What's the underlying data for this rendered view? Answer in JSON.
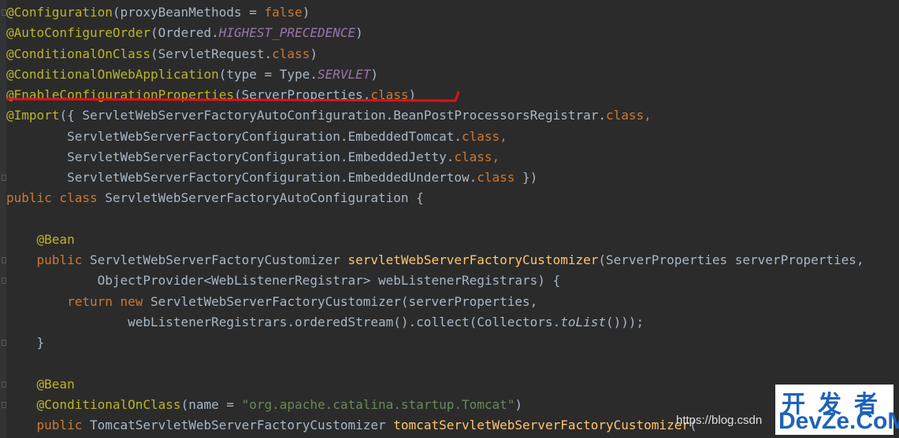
{
  "editor": {
    "lines": [
      [
        {
          "t": "@Configuration",
          "c": "ann"
        },
        {
          "t": "(proxyBeanMethods = ",
          "c": "plain"
        },
        {
          "t": "false",
          "c": "kw"
        },
        {
          "t": ")",
          "c": "plain"
        }
      ],
      [
        {
          "t": "@AutoConfigureOrder",
          "c": "ann"
        },
        {
          "t": "(Ordered.",
          "c": "plain"
        },
        {
          "t": "HIGHEST_PRECEDENCE",
          "c": "const"
        },
        {
          "t": ")",
          "c": "plain"
        }
      ],
      [
        {
          "t": "@ConditionalOnClass",
          "c": "ann"
        },
        {
          "t": "(ServletRequest.",
          "c": "plain"
        },
        {
          "t": "class",
          "c": "kw"
        },
        {
          "t": ")",
          "c": "plain"
        }
      ],
      [
        {
          "t": "@ConditionalOnWebApplication",
          "c": "ann"
        },
        {
          "t": "(type = Type.",
          "c": "plain"
        },
        {
          "t": "SERVLET",
          "c": "const"
        },
        {
          "t": ")",
          "c": "plain"
        }
      ],
      [
        {
          "t": "@EnableConfigurationProperties",
          "c": "ann"
        },
        {
          "t": "(ServerProperties.",
          "c": "plain"
        },
        {
          "t": "class",
          "c": "kw"
        },
        {
          "t": ")",
          "c": "plain"
        }
      ],
      [
        {
          "t": "@Import",
          "c": "ann"
        },
        {
          "t": "({ ServletWebServerFactoryAutoConfiguration.BeanPostProcessorsRegistrar.",
          "c": "plain"
        },
        {
          "t": "class,",
          "c": "kw"
        }
      ],
      [
        {
          "t": "        ServletWebServerFactoryConfiguration.EmbeddedTomcat.",
          "c": "plain"
        },
        {
          "t": "class,",
          "c": "kw"
        }
      ],
      [
        {
          "t": "        ServletWebServerFactoryConfiguration.EmbeddedJetty.",
          "c": "plain"
        },
        {
          "t": "class,",
          "c": "kw"
        }
      ],
      [
        {
          "t": "        ServletWebServerFactoryConfiguration.EmbeddedUndertow.",
          "c": "plain"
        },
        {
          "t": "class",
          "c": "kw"
        },
        {
          "t": " })",
          "c": "plain"
        }
      ],
      [
        {
          "t": "public class ",
          "c": "kw"
        },
        {
          "t": "ServletWebServerFactoryAutoConfiguration {",
          "c": "plain"
        }
      ],
      [
        {
          "t": "",
          "c": "plain"
        }
      ],
      [
        {
          "t": "    ",
          "c": "plain"
        },
        {
          "t": "@Bean",
          "c": "ann"
        }
      ],
      [
        {
          "t": "    ",
          "c": "plain"
        },
        {
          "t": "public ",
          "c": "kw"
        },
        {
          "t": "ServletWebServerFactoryCustomizer ",
          "c": "plain"
        },
        {
          "t": "servletWebServerFactoryCustomizer",
          "c": "fn"
        },
        {
          "t": "(ServerProperties serverProperties,",
          "c": "plain"
        }
      ],
      [
        {
          "t": "            ObjectProvider<WebListenerRegistrar> webListenerRegistrars) {",
          "c": "plain"
        }
      ],
      [
        {
          "t": "        ",
          "c": "plain"
        },
        {
          "t": "return new ",
          "c": "kw"
        },
        {
          "t": "ServletWebServerFactoryCustomizer(serverProperties,",
          "c": "plain"
        }
      ],
      [
        {
          "t": "                webListenerRegistrars.orderedStream().collect(Collectors.",
          "c": "plain"
        },
        {
          "t": "toList",
          "c": "it"
        },
        {
          "t": "()));",
          "c": "plain"
        }
      ],
      [
        {
          "t": "    }",
          "c": "plain"
        }
      ],
      [
        {
          "t": "",
          "c": "plain"
        }
      ],
      [
        {
          "t": "    ",
          "c": "plain"
        },
        {
          "t": "@Bean",
          "c": "ann"
        }
      ],
      [
        {
          "t": "    ",
          "c": "plain"
        },
        {
          "t": "@ConditionalOnClass",
          "c": "ann"
        },
        {
          "t": "(name = ",
          "c": "plain"
        },
        {
          "t": "\"org.apache.catalina.startup.Tomcat\"",
          "c": "str"
        },
        {
          "t": ")",
          "c": "plain"
        }
      ],
      [
        {
          "t": "    ",
          "c": "plain"
        },
        {
          "t": "public ",
          "c": "kw"
        },
        {
          "t": "TomcatServletWebServerFactoryCustomizer ",
          "c": "plain"
        },
        {
          "t": "tomcatServletWebServerFactoryCustomizer",
          "c": "fn"
        },
        {
          "t": "(",
          "c": "plain"
        }
      ]
    ]
  },
  "watermark": {
    "url": "https://blog.csdn"
  },
  "logo": {
    "cn": "开发者",
    "en": "DevZe.CoM"
  },
  "colors": {
    "background": "#2b2b2b",
    "annotation": "#bbb529",
    "keyword": "#cc7832",
    "constant": "#9876aa",
    "string": "#6a8759",
    "method": "#ffc66d",
    "highlight_underline": "#e0101a"
  }
}
